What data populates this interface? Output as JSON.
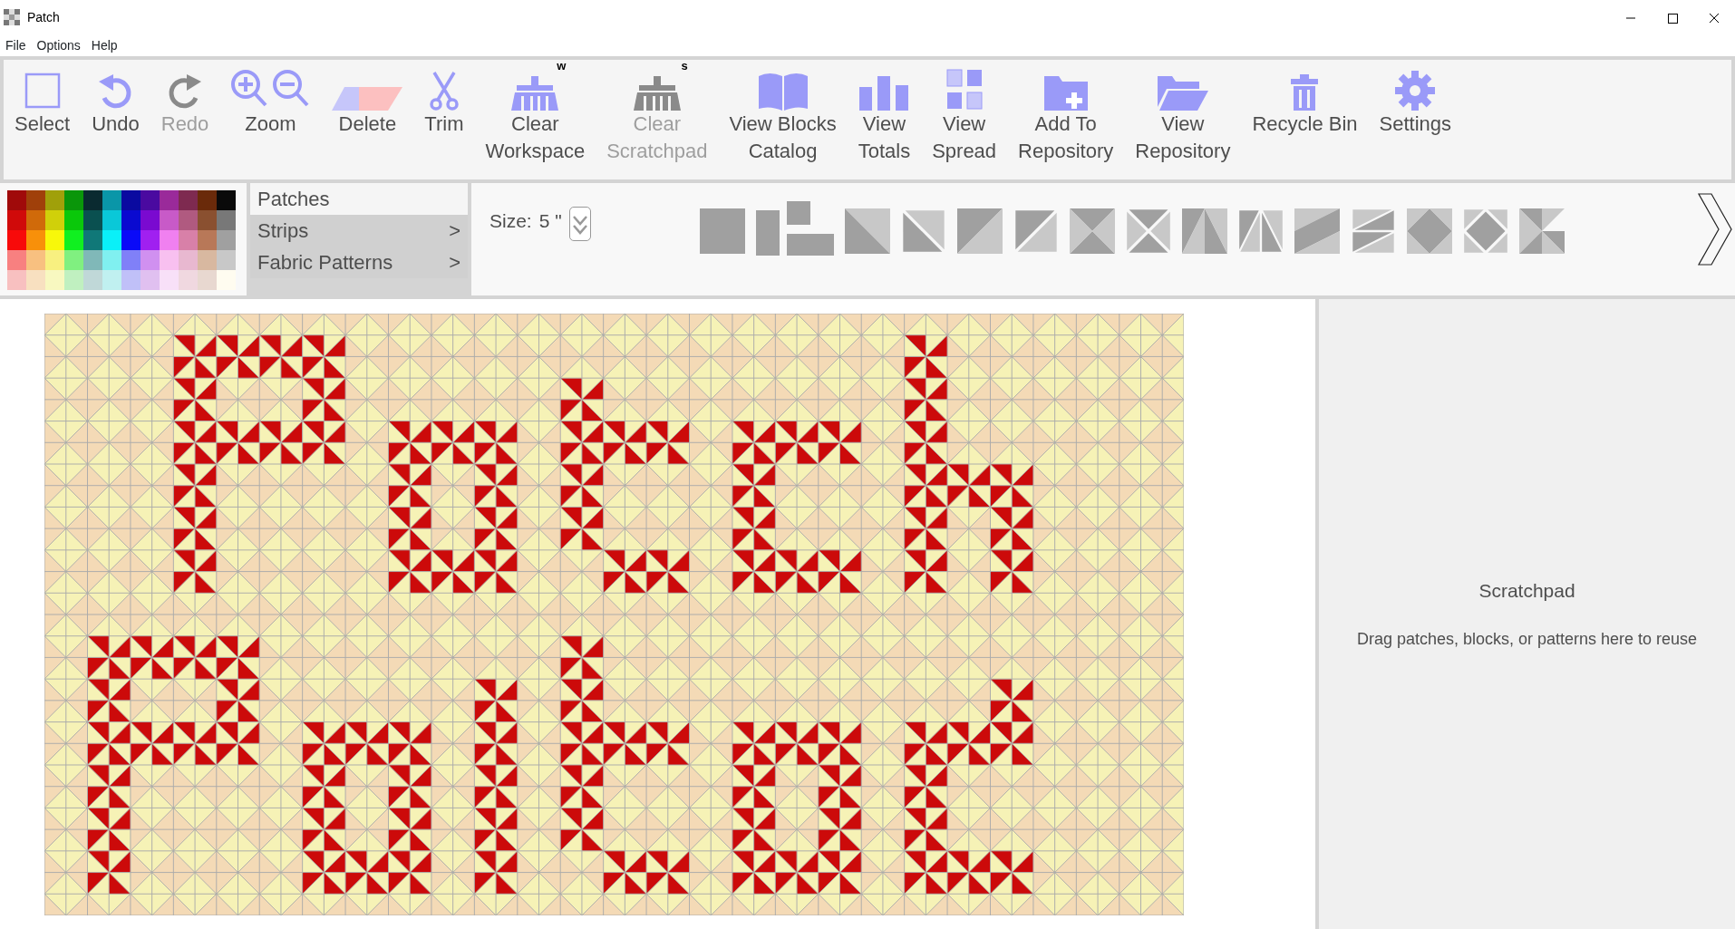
{
  "window": {
    "title": "Patch"
  },
  "menu": [
    "File",
    "Options",
    "Help"
  ],
  "toolbar": [
    {
      "kind": "select",
      "label": "Select",
      "disabled": false
    },
    {
      "kind": "undo",
      "label": "Undo",
      "disabled": false
    },
    {
      "kind": "redo",
      "label": "Redo",
      "disabled": true
    },
    {
      "kind": "zoom",
      "label": "Zoom",
      "disabled": false
    },
    {
      "kind": "delete",
      "label": "Delete",
      "disabled": false
    },
    {
      "kind": "trim",
      "label": "Trim",
      "disabled": false
    },
    {
      "kind": "broom",
      "label": "Clear Workspace",
      "superscript": "w",
      "disabled": false
    },
    {
      "kind": "broom",
      "label": "Clear Scratchpad",
      "superscript": "s",
      "disabled": true
    },
    {
      "kind": "book",
      "label": "View Blocks Catalog",
      "disabled": false
    },
    {
      "kind": "bars",
      "label": "View Totals",
      "disabled": false
    },
    {
      "kind": "grid",
      "label": "View Spread",
      "disabled": false
    },
    {
      "kind": "folder-plus",
      "label": "Add To Repository",
      "disabled": false
    },
    {
      "kind": "folder-open",
      "label": "View Repository",
      "disabled": false
    },
    {
      "kind": "trash",
      "label": "Recycle Bin",
      "disabled": false
    },
    {
      "kind": "gear",
      "label": "Settings",
      "disabled": false
    }
  ],
  "palette": [
    {
      "color": "#a00a0a"
    },
    {
      "color": "#a0400a"
    },
    {
      "color": "#a0a00a"
    },
    {
      "color": "#0a960a"
    },
    {
      "color": "#0a2a30"
    },
    {
      "color": "#0a96a8"
    },
    {
      "color": "#0a0aa0"
    },
    {
      "color": "#4a0aa0"
    },
    {
      "color": "#9a2a9a"
    },
    {
      "color": "#7e2a50"
    },
    {
      "color": "#6a2a0a"
    },
    {
      "color": "#0a0a0a"
    },
    {
      "color": "#d00a0a"
    },
    {
      "color": "#d06a0a"
    },
    {
      "color": "#d0d00a"
    },
    {
      "color": "#0ac80a"
    },
    {
      "color": "#0a5050"
    },
    {
      "color": "#0ac8d8"
    },
    {
      "color": "#0a0ad0"
    },
    {
      "color": "#7a0ad0"
    },
    {
      "color": "#c85ac8"
    },
    {
      "color": "#b05a80"
    },
    {
      "color": "#8a5030"
    },
    {
      "color": "#787878"
    },
    {
      "color": "#f80a0a"
    },
    {
      "color": "#f8900a"
    },
    {
      "color": "#f8f80a"
    },
    {
      "color": "#10f020"
    },
    {
      "color": "#107878"
    },
    {
      "color": "#0af0f8"
    },
    {
      "color": "#0a0af8"
    },
    {
      "color": "#a020f0"
    },
    {
      "color": "#f080f0"
    },
    {
      "color": "#d880a8"
    },
    {
      "color": "#b87858"
    },
    {
      "color": "#a0a0a0"
    },
    {
      "color": "#f88080"
    },
    {
      "color": "#f8c080"
    },
    {
      "color": "#f8f080"
    },
    {
      "color": "#80f080"
    },
    {
      "color": "#80b8b8"
    },
    {
      "color": "#80f0f0"
    },
    {
      "color": "#8080f8"
    },
    {
      "color": "#d090f0"
    },
    {
      "color": "#f8c0f0"
    },
    {
      "color": "#e8b8d0"
    },
    {
      "color": "#d8b8a0"
    },
    {
      "color": "#c8c8c8"
    },
    {
      "color": "#f8c0c0"
    },
    {
      "color": "#f8e0c0"
    },
    {
      "color": "#f8f8c0"
    },
    {
      "color": "#c0f0c0"
    },
    {
      "color": "#c0d8d8"
    },
    {
      "color": "#c0f0f0"
    },
    {
      "color": "#c0c0f8"
    },
    {
      "color": "#e0c0f0"
    },
    {
      "color": "#f8e0f8"
    },
    {
      "color": "#f0d8e0"
    },
    {
      "color": "#e8d8d0"
    },
    {
      "color": "#fffcf0"
    }
  ],
  "categories": [
    {
      "label": "Patches",
      "selected": true
    },
    {
      "label": "Strips",
      "arrow": ">",
      "selected": false
    },
    {
      "label": "Fabric Patterns",
      "arrow": ">",
      "selected": false
    }
  ],
  "size": {
    "label": "Size:",
    "value": "5",
    "unit": "\""
  },
  "shapes": [
    {
      "kind": "square"
    },
    {
      "kind": "bars"
    },
    {
      "kind": "hst"
    },
    {
      "kind": "hst-gap"
    },
    {
      "kind": "hst-rev"
    },
    {
      "kind": "hst-rev-gap"
    },
    {
      "kind": "hourglass"
    },
    {
      "kind": "hourglass-gap"
    },
    {
      "kind": "tri-v"
    },
    {
      "kind": "tri-v-gap"
    },
    {
      "kind": "tri-h"
    },
    {
      "kind": "tri-h-gap"
    },
    {
      "kind": "diamond"
    },
    {
      "kind": "diamond-gap"
    },
    {
      "kind": "pinwheel"
    }
  ],
  "scratchpad": {
    "title": "Scratchpad",
    "hint": "Drag patches, blocks, or patterns here to reuse"
  }
}
